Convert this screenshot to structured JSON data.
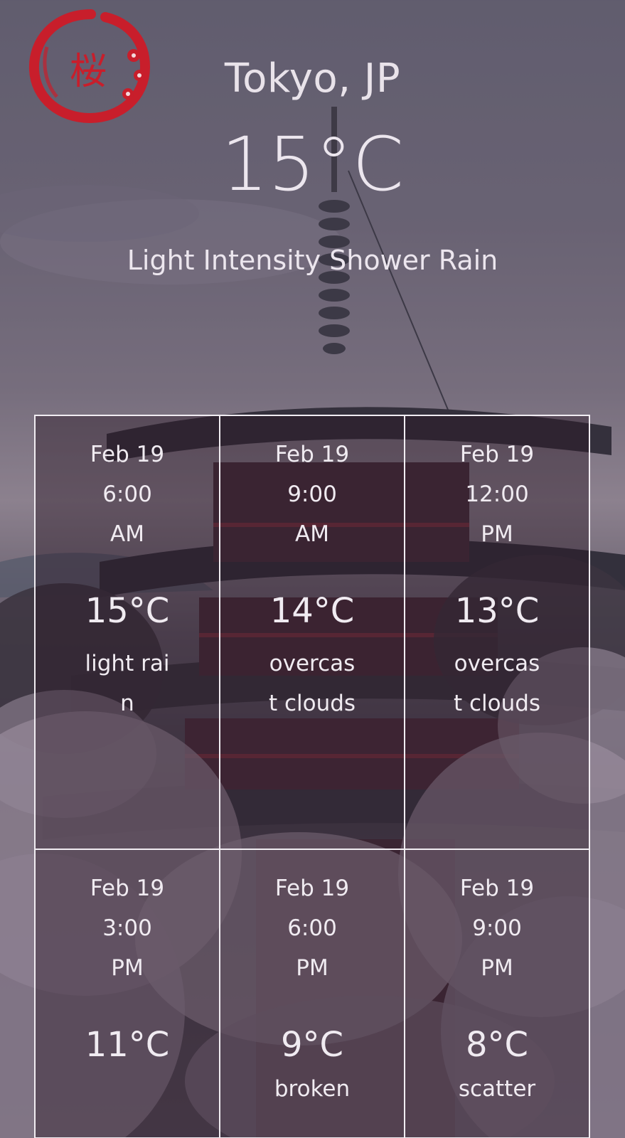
{
  "logo": {
    "glyph": "桜",
    "color": "#c81e2b"
  },
  "header": {
    "city": "Tokyo, JP",
    "temperature": "15°C",
    "description": "Light Intensity Shower Rain"
  },
  "forecast": [
    {
      "date": "Feb 19",
      "time": "6:00",
      "period": "AM",
      "temp": "15°C",
      "weather": "light rain"
    },
    {
      "date": "Feb 19",
      "time": "9:00",
      "period": "AM",
      "temp": "14°C",
      "weather": "overcast clouds"
    },
    {
      "date": "Feb 19",
      "time": "12:00",
      "period": "PM",
      "temp": "13°C",
      "weather": "overcast clouds"
    },
    {
      "date": "Feb 19",
      "time": "3:00",
      "period": "PM",
      "temp": "11°C",
      "weather": ""
    },
    {
      "date": "Feb 19",
      "time": "6:00",
      "period": "PM",
      "temp": "9°C",
      "weather": "broken"
    },
    {
      "date": "Feb 19",
      "time": "9:00",
      "period": "PM",
      "temp": "8°C",
      "weather": "scatter"
    }
  ],
  "colors": {
    "text": "#f0ebf1",
    "grid_border": "#f1edf2",
    "logo_red": "#c81e2b"
  }
}
